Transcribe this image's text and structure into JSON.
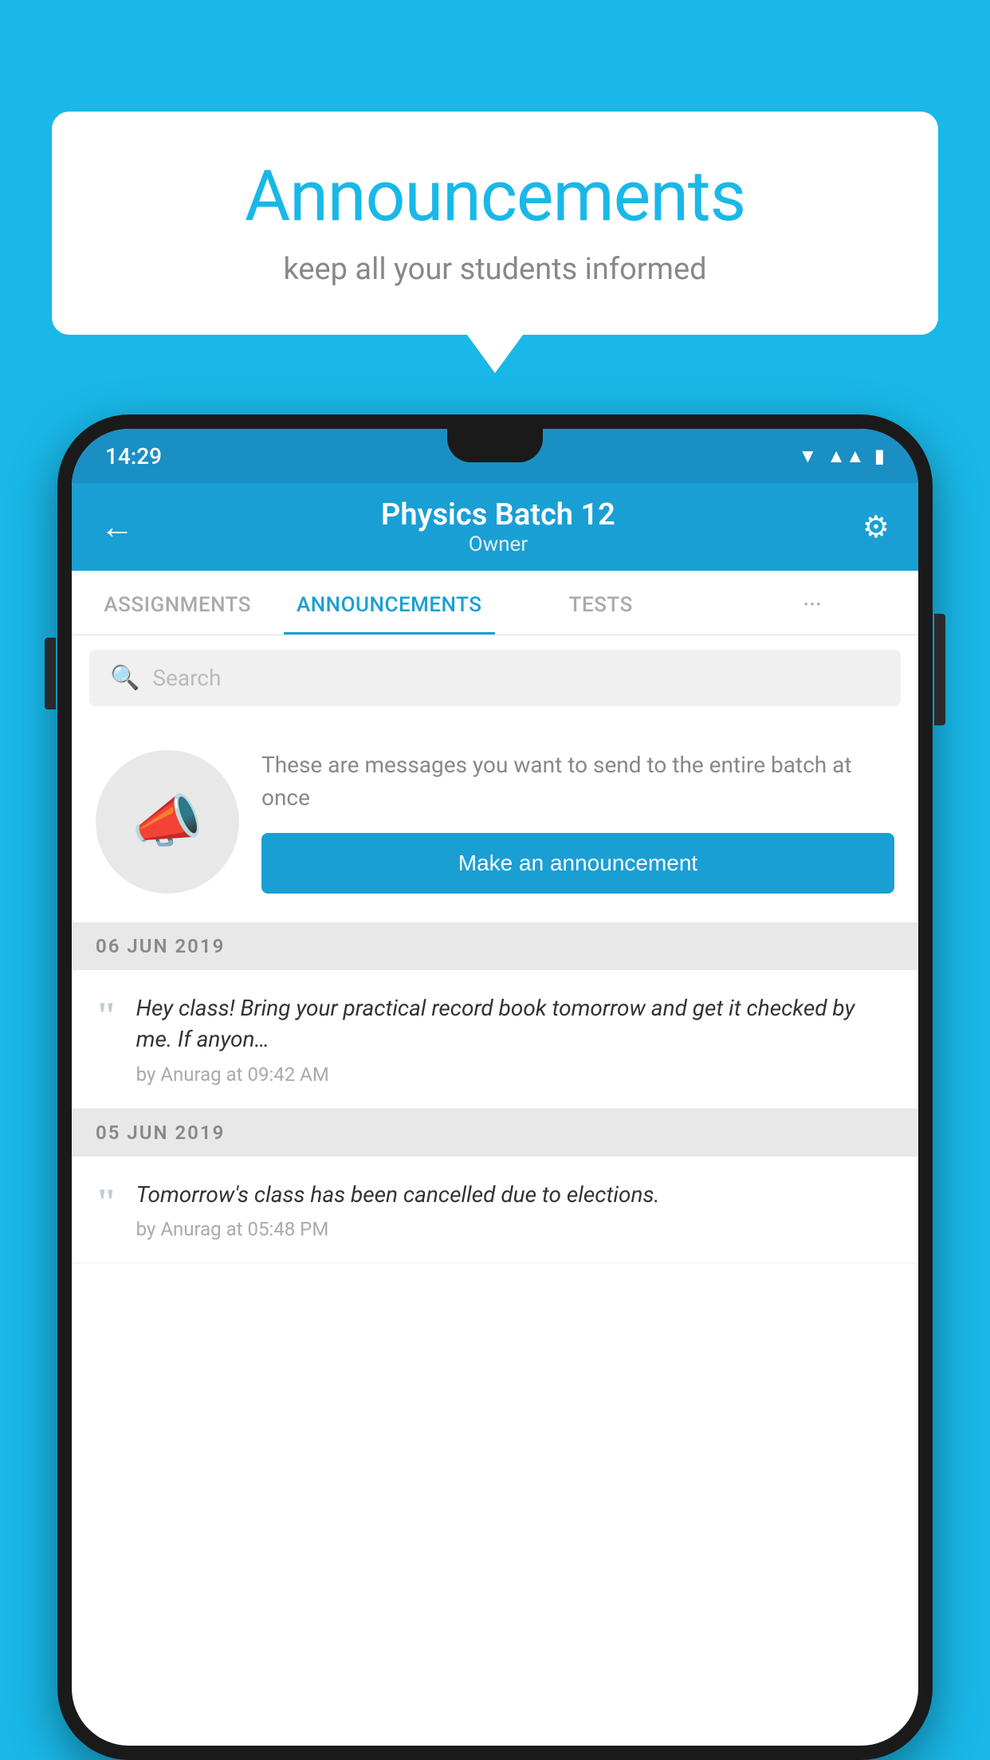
{
  "background_color": "#19b8e8",
  "bubble": {
    "title": "Announcements",
    "subtitle": "keep all your students informed"
  },
  "status_bar": {
    "time": "14:29"
  },
  "app_bar": {
    "title": "Physics Batch 12",
    "subtitle": "Owner",
    "back_label": "←"
  },
  "tabs": [
    {
      "label": "ASSIGNMENTS",
      "active": false
    },
    {
      "label": "ANNOUNCEMENTS",
      "active": true
    },
    {
      "label": "TESTS",
      "active": false
    },
    {
      "label": "···",
      "active": false
    }
  ],
  "search": {
    "placeholder": "Search"
  },
  "promo": {
    "description": "These are messages you want to send to the entire batch at once",
    "button_label": "Make an announcement"
  },
  "announcements": [
    {
      "date": "06  JUN  2019",
      "message": "Hey class! Bring your practical record book tomorrow and get it checked by me. If anyon…",
      "meta": "by Anurag at 09:42 AM"
    },
    {
      "date": "05  JUN  2019",
      "message": "Tomorrow's class has been cancelled due to elections.",
      "meta": "by Anurag at 05:48 PM"
    }
  ]
}
